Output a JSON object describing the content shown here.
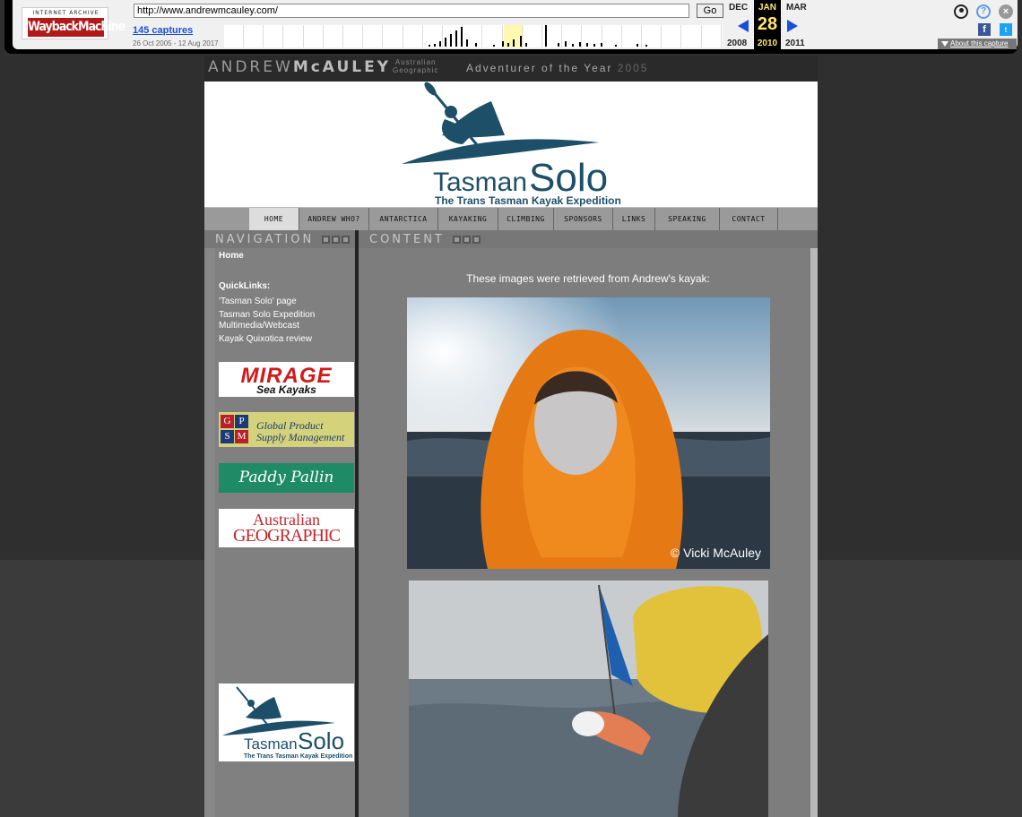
{
  "wayback": {
    "logo_top": "INTERNET ARCHIVE",
    "logo_main": "WaybackMachine",
    "url": "http://www.andrewmcauley.com/",
    "go_label": "Go",
    "captures": "145 captures",
    "range": "26 Oct 2005 - 12 Aug 2017",
    "prev_month": "DEC",
    "cur_month": "JAN",
    "next_month": "MAR",
    "cur_day": "28",
    "prev_year": "2008",
    "cur_year": "2010",
    "next_year": "2011",
    "about": "About this capture",
    "help_glyph": "?",
    "close_glyph": "×",
    "fb_glyph": "f",
    "tw_glyph": "t"
  },
  "site": {
    "name_light": "ANDREW",
    "name_bold": "McAULEY",
    "ag_line1": "Australian",
    "ag_line2": "Geographic",
    "tagline": "Adventurer of the Year",
    "tagline_year": "2005"
  },
  "banner": {
    "title_a": "Tasman",
    "title_b": "Solo",
    "subtitle": "The Trans Tasman Kayak Expedition"
  },
  "nav": {
    "items": [
      "HOME",
      "ANDREW WHO?",
      "ANTARCTICA",
      "KAYAKING",
      "CLIMBING",
      "SPONSORS",
      "LINKS",
      "SPEAKING",
      "CONTACT"
    ]
  },
  "sidebar": {
    "title": "NAVIGATION",
    "home": "Home",
    "quicklinks": "QuickLinks:",
    "links": [
      "'Tasman Solo' page",
      "Tasman Solo Expedition Multimedia/Webcast",
      "Kayak Quixotica review"
    ],
    "ads": {
      "mirage_a": "MIRAGE",
      "mirage_b": "Sea Kayaks",
      "gpsm_letters": [
        "G",
        "P",
        "S",
        "M"
      ],
      "gpsm_text_1": "Global Product",
      "gpsm_text_2": "Supply Management",
      "paddy": "Paddy Pallin",
      "ag_1": "Australian",
      "ag_2": "GEOGRAPHIC"
    }
  },
  "content": {
    "title": "CONTENT",
    "intro": "These images were retrieved from Andrew's kayak:",
    "photo1_caption": "© Vicki McAuley"
  }
}
